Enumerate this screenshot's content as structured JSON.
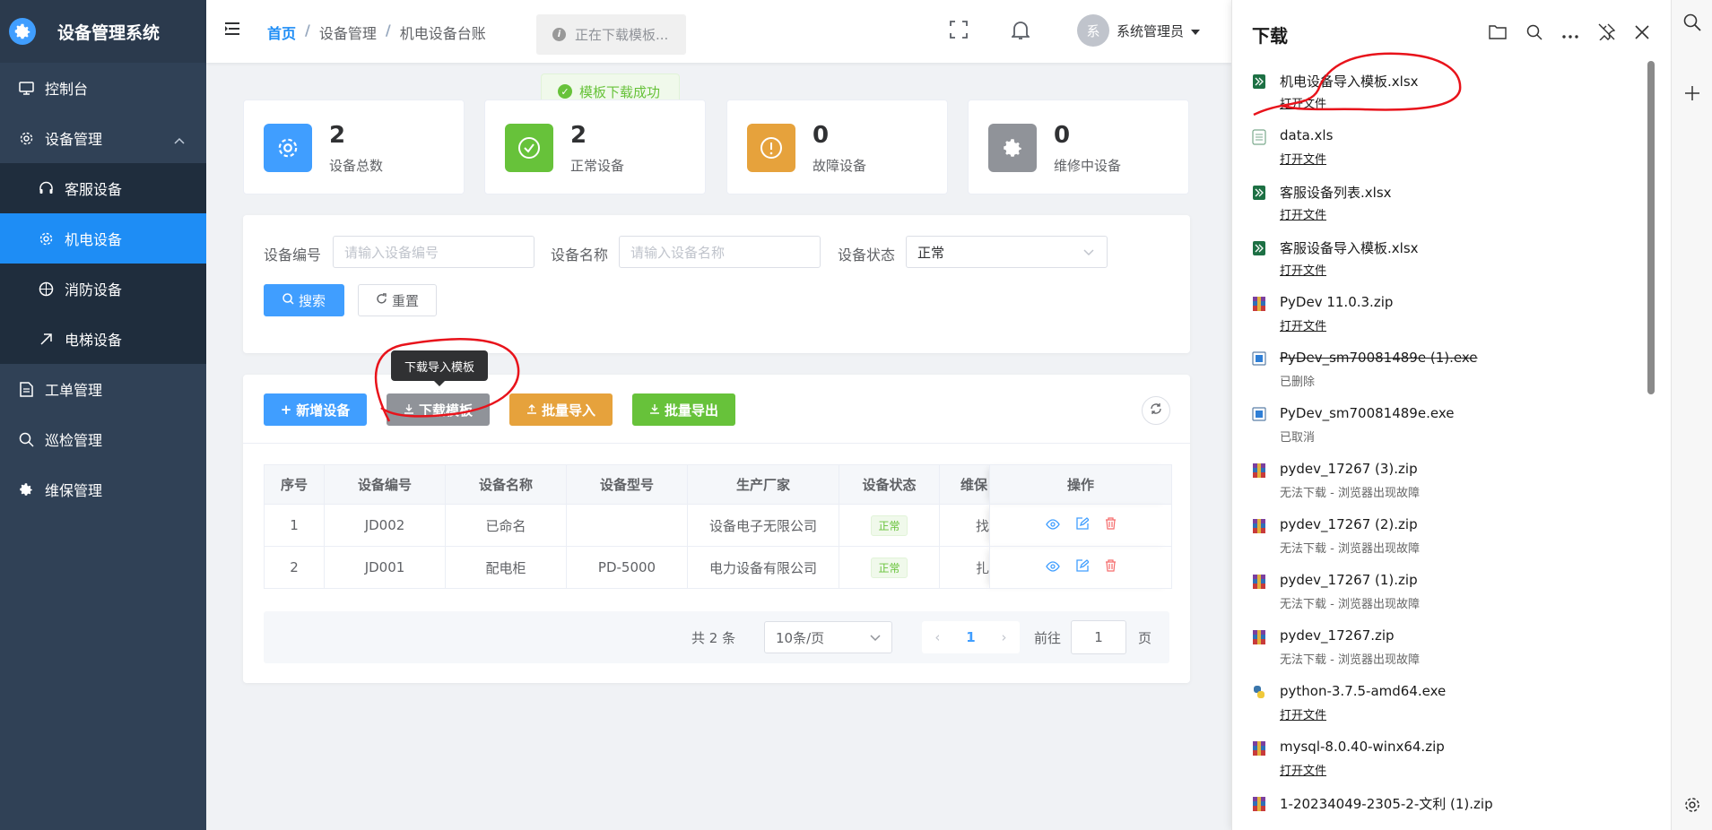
{
  "sidebar": {
    "title": "设备管理系统",
    "items": [
      {
        "label": "控制台"
      },
      {
        "label": "设备管理"
      },
      {
        "label": "客服设备"
      },
      {
        "label": "机电设备"
      },
      {
        "label": "消防设备"
      },
      {
        "label": "电梯设备"
      },
      {
        "label": "工单管理"
      },
      {
        "label": "巡检管理"
      },
      {
        "label": "维保管理"
      }
    ]
  },
  "header": {
    "breadcrumb": [
      "首页",
      "设备管理",
      "机电设备台账"
    ],
    "separator": "/",
    "download_status": "正在下载模板...",
    "user_avatar": "系",
    "user_name": "系统管理员"
  },
  "toast": "模板下载成功",
  "stats": [
    {
      "value": "2",
      "label": "设备总数",
      "color": "#409eff"
    },
    {
      "value": "2",
      "label": "正常设备",
      "color": "#67c23a"
    },
    {
      "value": "0",
      "label": "故障设备",
      "color": "#e6a23c"
    },
    {
      "value": "0",
      "label": "维修中设备",
      "color": "#909399"
    }
  ],
  "search": {
    "code_label": "设备编号",
    "code_placeholder": "请输入设备编号",
    "name_label": "设备名称",
    "name_placeholder": "请输入设备名称",
    "status_label": "设备状态",
    "status_value": "正常",
    "search_btn": "搜索",
    "reset_btn": "重置"
  },
  "toolbar": {
    "add": "新增设备",
    "template": "下载模板",
    "import": "批量导入",
    "export": "批量导出",
    "tooltip": "下载导入模板"
  },
  "table": {
    "headers": [
      "序号",
      "设备编号",
      "设备名称",
      "设备型号",
      "生产厂家",
      "设备状态",
      "维保",
      "操作"
    ],
    "rows": [
      {
        "idx": "1",
        "code": "JD002",
        "name": "已命名",
        "model": "",
        "maker": "设备电子无限公司",
        "status": "正常",
        "maint": "找"
      },
      {
        "idx": "2",
        "code": "JD001",
        "name": "配电柜",
        "model": "PD-5000",
        "maker": "电力设备有限公司",
        "status": "正常",
        "maint": "扎"
      }
    ]
  },
  "pagination": {
    "total": "共 2 条",
    "page_size": "10条/页",
    "current": "1",
    "goto_label": "前往",
    "goto_value": "1",
    "page_word": "页"
  },
  "downloads": {
    "title": "下载",
    "items": [
      {
        "name": "机电设备导入模板.xlsx",
        "sub": "打开文件",
        "type": "xlsx"
      },
      {
        "name": "data.xls",
        "sub": "打开文件",
        "type": "xls"
      },
      {
        "name": "客服设备列表.xlsx",
        "sub": "打开文件",
        "type": "xlsx"
      },
      {
        "name": "客服设备导入模板.xlsx",
        "sub": "打开文件",
        "type": "xlsx"
      },
      {
        "name": "PyDev 11.0.3.zip",
        "sub": "打开文件",
        "type": "zip"
      },
      {
        "name": "PyDev_sm70081489e (1).exe",
        "sub": "已删除",
        "type": "exe"
      },
      {
        "name": "PyDev_sm70081489e.exe",
        "sub": "已取消",
        "type": "exe"
      },
      {
        "name": "pydev_17267 (3).zip",
        "sub": "无法下载 - 浏览器出现故障",
        "type": "zip"
      },
      {
        "name": "pydev_17267 (2).zip",
        "sub": "无法下载 - 浏览器出现故障",
        "type": "zip"
      },
      {
        "name": "pydev_17267 (1).zip",
        "sub": "无法下载 - 浏览器出现故障",
        "type": "zip"
      },
      {
        "name": "pydev_17267.zip",
        "sub": "无法下载 - 浏览器出现故障",
        "type": "zip"
      },
      {
        "name": "python-3.7.5-amd64.exe",
        "sub": "打开文件",
        "type": "py"
      },
      {
        "name": "mysql-8.0.40-winx64.zip",
        "sub": "打开文件",
        "type": "zip"
      },
      {
        "name": "1-20234049-2305-2-文利 (1).zip",
        "sub": "",
        "type": "zip"
      }
    ]
  }
}
